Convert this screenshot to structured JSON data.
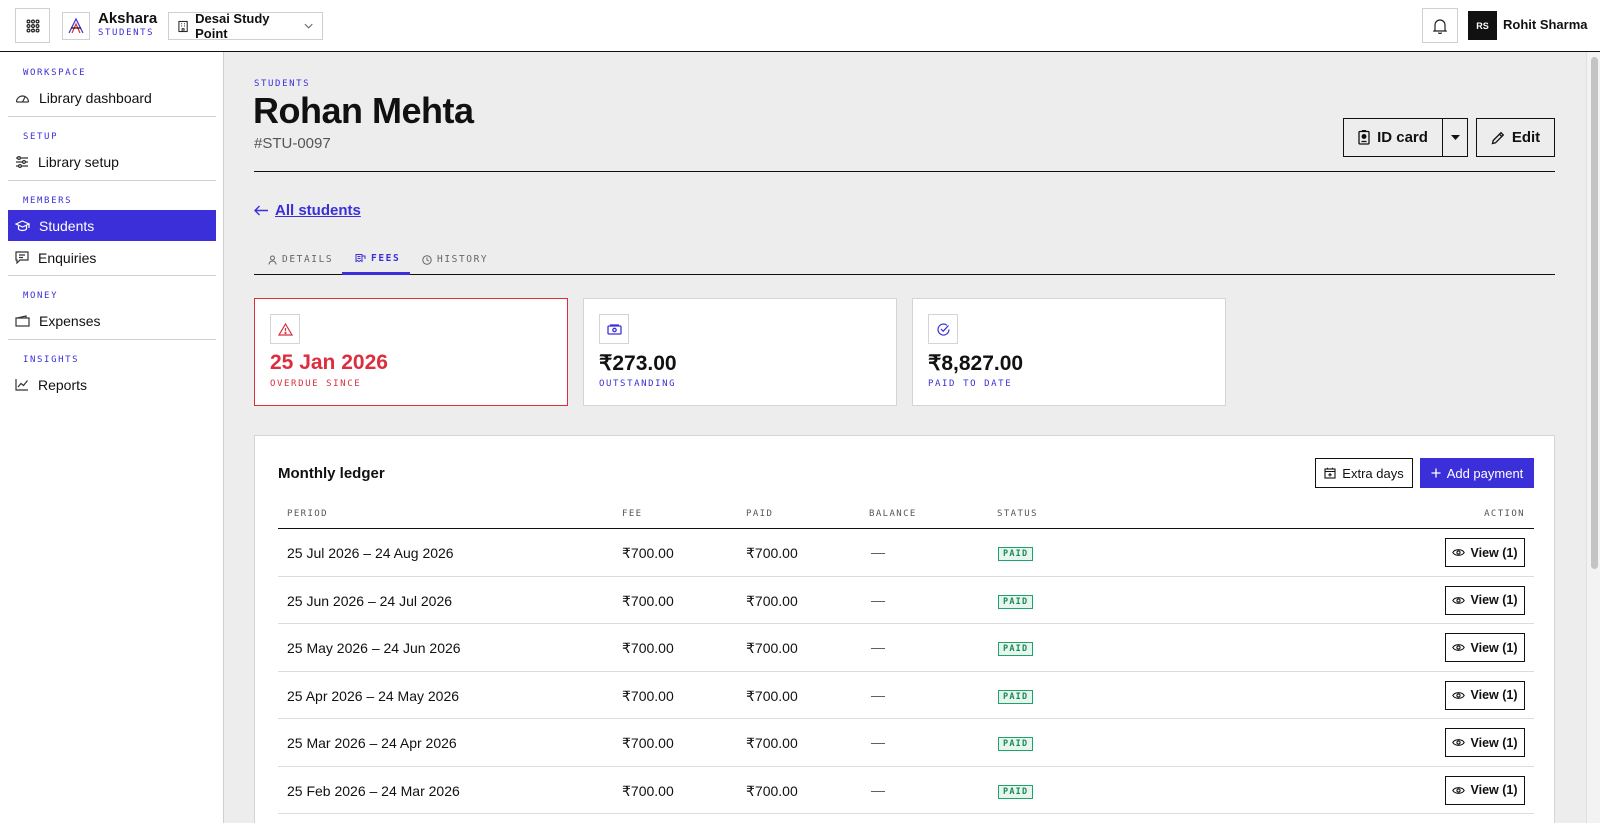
{
  "topbar": {
    "brand_name": "Akshara",
    "brand_sub": "STUDENTS",
    "org_name": "Desai Study Point",
    "user_initials": "RS",
    "user_name": "Rohit Sharma"
  },
  "sidebar": {
    "sections": [
      {
        "heading": "WORKSPACE",
        "items": [
          {
            "label": "Library dashboard",
            "icon": "gauge-icon"
          }
        ]
      },
      {
        "heading": "SETUP",
        "items": [
          {
            "label": "Library setup",
            "icon": "sliders-icon"
          }
        ]
      },
      {
        "heading": "MEMBERS",
        "items": [
          {
            "label": "Students",
            "icon": "graduation-cap-icon",
            "active": true
          },
          {
            "label": "Enquiries",
            "icon": "message-icon"
          }
        ]
      },
      {
        "heading": "MONEY",
        "items": [
          {
            "label": "Expenses",
            "icon": "wallet-icon"
          }
        ]
      },
      {
        "heading": "INSIGHTS",
        "items": [
          {
            "label": "Reports",
            "icon": "chart-line-icon"
          }
        ]
      }
    ]
  },
  "header": {
    "crumb": "STUDENTS",
    "title": "Rohan Mehta",
    "student_id": "#STU-0097",
    "id_card_label": "ID card",
    "edit_label": "Edit",
    "back_label": "All students"
  },
  "tabs": [
    {
      "label": "DETAILS",
      "icon": "user-icon"
    },
    {
      "label": "FEES",
      "icon": "receipt-icon",
      "active": true
    },
    {
      "label": "HISTORY",
      "icon": "clock-icon"
    }
  ],
  "cards": [
    {
      "value": "25 Jan 2026",
      "label": "OVERDUE SINCE",
      "icon": "warning-icon"
    },
    {
      "value": "₹273.00",
      "label": "OUTSTANDING",
      "icon": "banknote-icon"
    },
    {
      "value": "₹8,827.00",
      "label": "PAID TO DATE",
      "icon": "check-circle-icon"
    }
  ],
  "ledger": {
    "title": "Monthly ledger",
    "extra_days_label": "Extra days",
    "add_payment_label": "Add payment",
    "columns": [
      "PERIOD",
      "FEE",
      "PAID",
      "BALANCE",
      "STATUS",
      "ACTION"
    ],
    "rows": [
      {
        "period": "25 Jul 2026 – 24 Aug 2026",
        "fee": "₹700.00",
        "paid": "₹700.00",
        "balance": "—",
        "status": "PAID",
        "action": "View (1)"
      },
      {
        "period": "25 Jun 2026 – 24 Jul 2026",
        "fee": "₹700.00",
        "paid": "₹700.00",
        "balance": "—",
        "status": "PAID",
        "action": "View (1)"
      },
      {
        "period": "25 May 2026 – 24 Jun 2026",
        "fee": "₹700.00",
        "paid": "₹700.00",
        "balance": "—",
        "status": "PAID",
        "action": "View (1)"
      },
      {
        "period": "25 Apr 2026 – 24 May 2026",
        "fee": "₹700.00",
        "paid": "₹700.00",
        "balance": "—",
        "status": "PAID",
        "action": "View (1)"
      },
      {
        "period": "25 Mar 2026 – 24 Apr 2026",
        "fee": "₹700.00",
        "paid": "₹700.00",
        "balance": "—",
        "status": "PAID",
        "action": "View (1)"
      },
      {
        "period": "25 Feb 2026 – 24 Mar 2026",
        "fee": "₹700.00",
        "paid": "₹700.00",
        "balance": "—",
        "status": "PAID",
        "action": "View (1)"
      }
    ]
  },
  "colors": {
    "accent": "#3b2fd9",
    "danger": "#dc2e3e",
    "paid_green": "#1a8a58"
  }
}
